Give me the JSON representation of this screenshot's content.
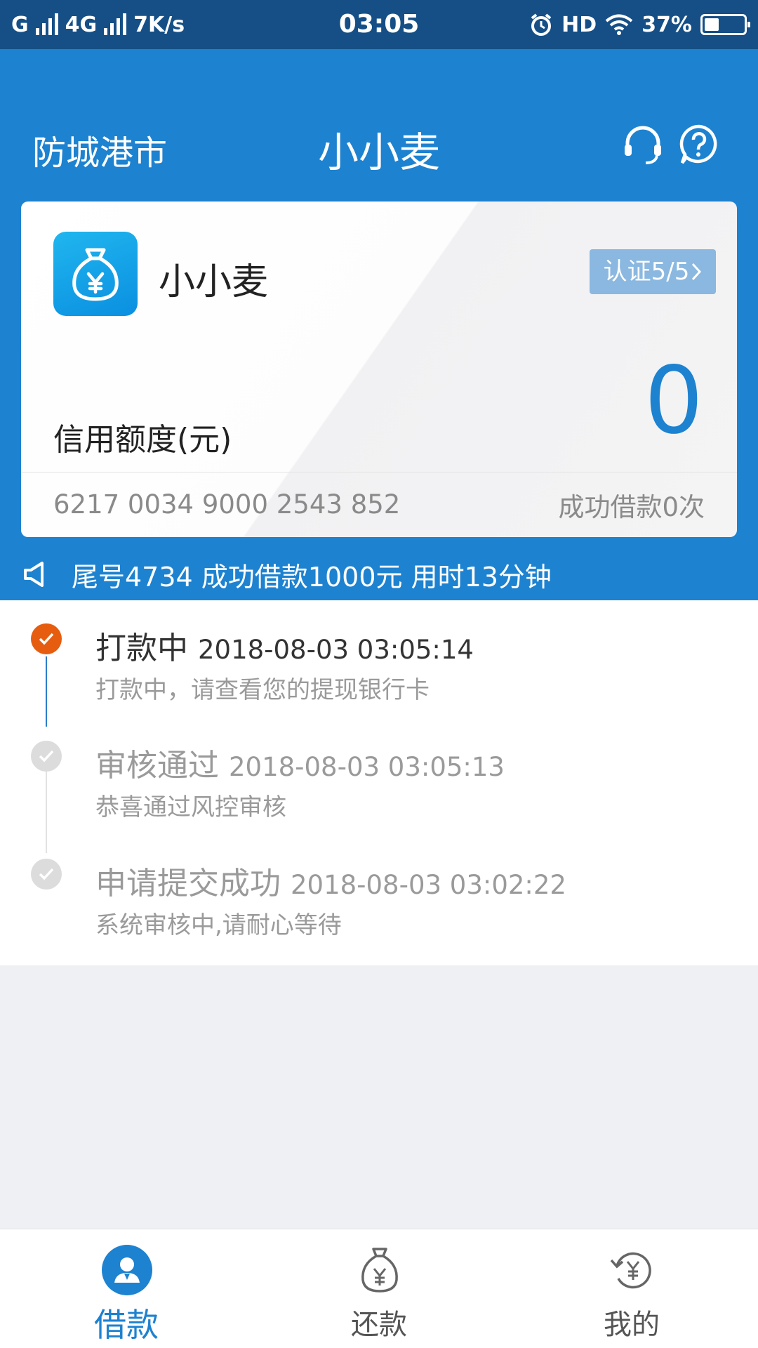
{
  "status_bar": {
    "network1": "G",
    "network2": "4G",
    "speed": "7K/s",
    "time": "03:05",
    "hd": "HD",
    "battery_percent": "37%",
    "battery_level": 0.37
  },
  "header": {
    "city": "防城港市",
    "title": "小小麦",
    "icons": [
      "headset-icon",
      "help-icon"
    ]
  },
  "card": {
    "name": "小小麦",
    "logo_icon": "money-bag-icon",
    "verify_label": "认证5/5",
    "limit_label": "信用额度(元)",
    "limit_value": "0",
    "card_number": "6217 0034 9000 2543 852",
    "success_count": "成功借款0次"
  },
  "notice": {
    "icon": "speaker-icon",
    "text": "尾号4734 成功借款1000元 用时13分钟"
  },
  "timeline": [
    {
      "title": "打款中",
      "timestamp": "2018-08-03 03:05:14",
      "desc": "打款中，请查看您的提现银行卡",
      "active": true
    },
    {
      "title": "审核通过",
      "timestamp": "2018-08-03 03:05:13",
      "desc": "恭喜通过风控审核",
      "active": false
    },
    {
      "title": "申请提交成功",
      "timestamp": "2018-08-03 03:02:22",
      "desc": "系统审核中,请耐心等待",
      "active": false
    }
  ],
  "bottom_nav": [
    {
      "label": "借款",
      "icon": "borrow-user-icon",
      "active": true
    },
    {
      "label": "还款",
      "icon": "repay-bag-icon",
      "active": false
    },
    {
      "label": "我的",
      "icon": "mine-refresh-icon",
      "active": false
    }
  ],
  "colors": {
    "primary": "#1d82d0",
    "status_bar": "#154f86",
    "active_step": "#e65d10",
    "verify_button": "#8ab8e0"
  }
}
